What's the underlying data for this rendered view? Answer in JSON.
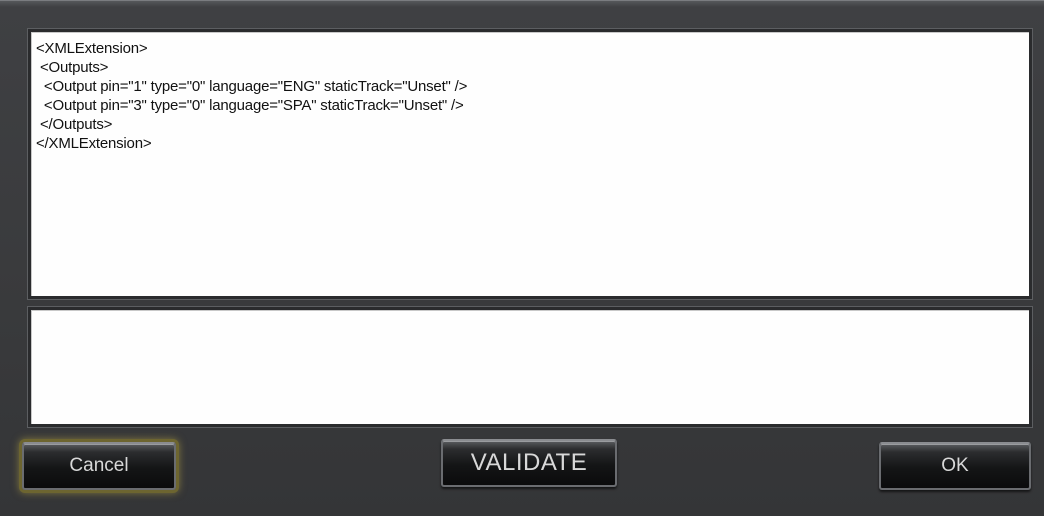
{
  "editor": {
    "lines": [
      "<XMLExtension>",
      " <Outputs>",
      "  <Output pin=\"1\" type=\"0\" language=\"ENG\" staticTrack=\"Unset\" />",
      "  <Output pin=\"3\" type=\"0\" language=\"SPA\" staticTrack=\"Unset\" />",
      " </Outputs>",
      "</XMLExtension>"
    ]
  },
  "output": {
    "text": ""
  },
  "buttons": {
    "cancel": "Cancel",
    "validate": "VALIDATE",
    "ok": "OK"
  }
}
